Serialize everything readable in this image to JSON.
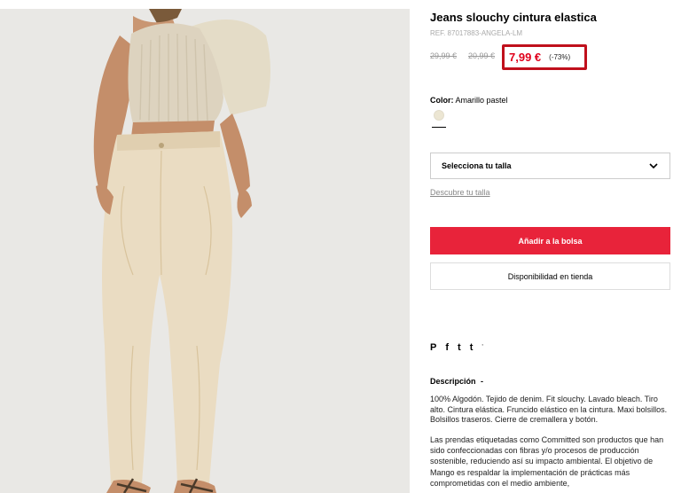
{
  "product": {
    "title": "Jeans slouchy cintura elastica",
    "ref": "REF. 87017883-ANGELA-LM",
    "old_price_1": "29,99 €",
    "old_price_2": "20,99 €",
    "price": "7,99 €",
    "discount": "(-73%)",
    "color_label": "Color:",
    "color_value": "Amarillo pastel",
    "swatch_color": "#ece6d3"
  },
  "size": {
    "select_label": "Selecciona tu talla",
    "guide_link": "Descubre tu talla"
  },
  "actions": {
    "add_to_bag": "Añadir a la bolsa",
    "store_availability": "Disponibilidad en tienda"
  },
  "share": {
    "pinterest": "P",
    "facebook": "f",
    "twitter": "t",
    "tumblr": "t",
    "more": "'"
  },
  "description": {
    "title": "Descripción",
    "toggle": "-",
    "paragraph1": "100% Algodón. Tejido de denim. Fit slouchy. Lavado bleach. Tiro alto. Cintura elástica. Fruncido elástico en la cintura. Maxi bolsillos. Bolsillos traseros. Cierre de cremallera y botón.",
    "paragraph2": "Las prendas etiquetadas como Committed son productos que han sido confeccionadas con fibras y/o procesos de producción sostenible, reduciendo así su impacto ambiental. El objetivo de Mango es respaldar la implementación de prácticas más comprometidas con el medio ambiente,"
  },
  "colors": {
    "accent_red": "#e8233a",
    "price_red": "#e0001b",
    "highlight_border": "#c0101c"
  }
}
